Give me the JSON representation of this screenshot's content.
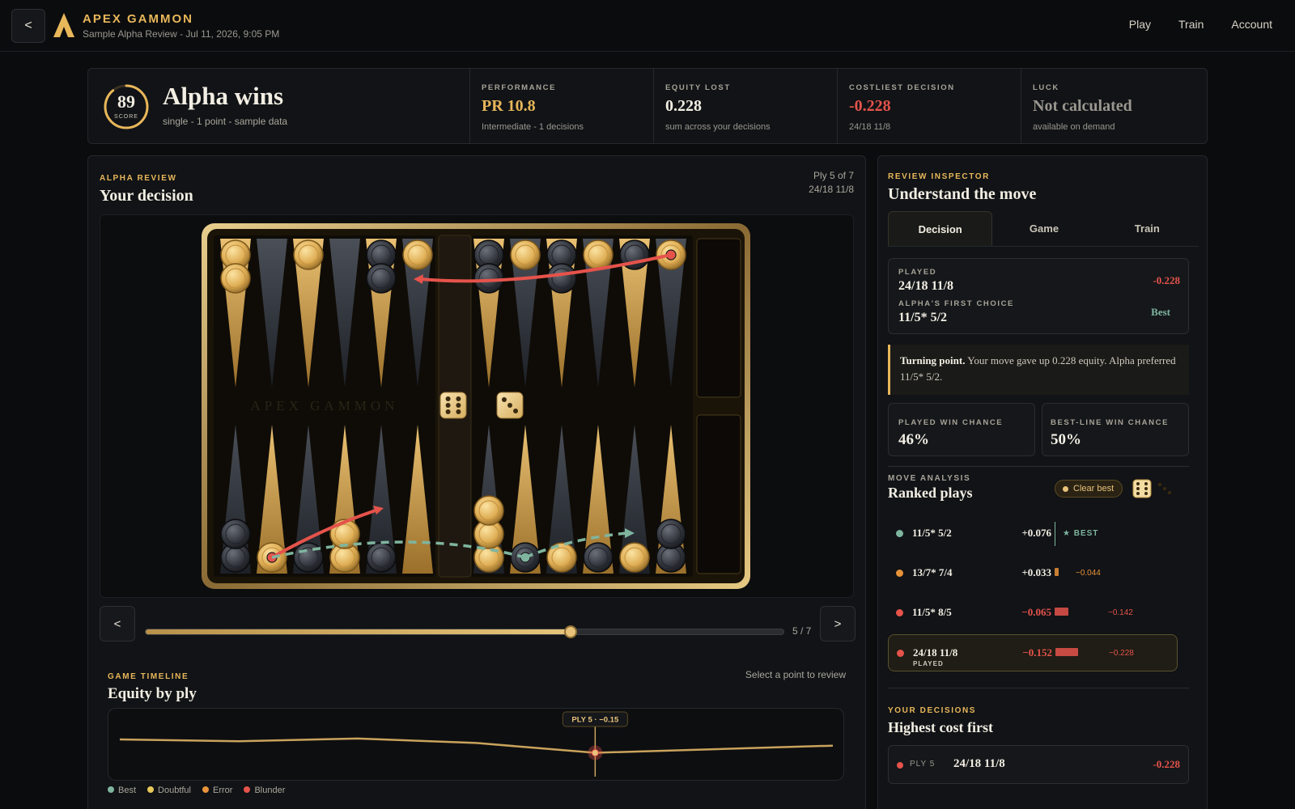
{
  "header": {
    "back_label": "<",
    "brand": "APEX GAMMON",
    "subtitle": "Sample Alpha Review - Jul 11, 2026, 9:05 PM",
    "nav": [
      "Play",
      "Train",
      "Account"
    ]
  },
  "summary": {
    "score": "89",
    "score_label": "SCORE",
    "score_fraction": 0.89,
    "title": "Alpha wins",
    "subtitle": "single - 1 point - sample data",
    "stats": [
      {
        "label": "PERFORMANCE",
        "value": "PR 10.8",
        "sub": "Intermediate - 1 decisions",
        "color": "#e8b75a"
      },
      {
        "label": "EQUITY LOST",
        "value": "0.228",
        "sub": "sum across your decisions",
        "color": "#f2eee3"
      },
      {
        "label": "COSTLIEST DECISION",
        "value": "-0.228",
        "sub": "24/18 11/8",
        "color": "#e5534b"
      },
      {
        "label": "LUCK",
        "value": "Not calculated",
        "sub": "available on demand",
        "color": "#9a978f"
      }
    ]
  },
  "review": {
    "label": "ALPHA REVIEW",
    "title": "Your decision",
    "ply": "Ply 5 of 7",
    "move": "24/18 11/8",
    "board_watermark": "APEX GAMMON",
    "dice": [
      6,
      3
    ],
    "board": {
      "top": [
        {
          "color": "gold",
          "count": 2
        },
        {
          "color": "none",
          "count": 0
        },
        {
          "color": "gold",
          "count": 1
        },
        {
          "color": "none",
          "count": 0
        },
        {
          "color": "dark",
          "count": 2
        },
        {
          "color": "gold",
          "count": 1
        },
        {
          "color": "dark",
          "count": 2
        },
        {
          "color": "gold",
          "count": 1
        },
        {
          "color": "dark",
          "count": 2
        },
        {
          "color": "gold",
          "count": 1
        },
        {
          "color": "dark",
          "count": 1
        },
        {
          "color": "gold",
          "count": 1,
          "marker": "red"
        }
      ],
      "bottom": [
        {
          "color": "dark",
          "count": 2
        },
        {
          "color": "gold",
          "count": 1,
          "marker": "red"
        },
        {
          "color": "dark",
          "count": 1
        },
        {
          "color": "gold",
          "count": 2
        },
        {
          "color": "dark",
          "count": 1
        },
        {
          "color": "none",
          "count": 0
        },
        {
          "color": "gold",
          "count": 3
        },
        {
          "color": "dark",
          "count": 1,
          "marker": "green"
        },
        {
          "color": "gold",
          "count": 1
        },
        {
          "color": "dark",
          "count": 1
        },
        {
          "color": "gold",
          "count": 1
        },
        {
          "color": "dark",
          "count": 2
        }
      ]
    }
  },
  "controls": {
    "prev": "<",
    "next": ">",
    "position": 5,
    "total": 7,
    "count_label": "5 / 7"
  },
  "timeline": {
    "label": "GAME TIMELINE",
    "title": "Equity by ply",
    "hint": "Select a point to review",
    "marker_label": "PLY 5 · −0.15",
    "equity": [
      0.0,
      -0.02,
      0.01,
      -0.04,
      -0.15,
      -0.11,
      -0.07
    ],
    "selected_index": 4,
    "legend": [
      {
        "name": "Best",
        "color": "#7fb59f"
      },
      {
        "name": "Doubtful",
        "color": "#e8c85a"
      },
      {
        "name": "Error",
        "color": "#e8923a"
      },
      {
        "name": "Blunder",
        "color": "#e5534b"
      }
    ]
  },
  "inspector": {
    "label": "REVIEW INSPECTOR",
    "title": "Understand the move",
    "tabs": [
      "Decision",
      "Game",
      "Train"
    ],
    "played_label": "PLAYED",
    "played_move": "24/18 11/8",
    "played_delta": "-0.228",
    "alpha_label": "ALPHA'S FIRST CHOICE",
    "alpha_move": "11/5* 5/2",
    "alpha_tag": "Best",
    "turning_bold": "Turning point.",
    "turning_text": "Your move gave up 0.228 equity. Alpha preferred 11/5* 5/2.",
    "win_played_label": "PLAYED WIN CHANCE",
    "win_played": "46%",
    "win_best_label": "BEST-LINE WIN CHANCE",
    "win_best": "50%",
    "analysis_label": "MOVE ANALYSIS",
    "analysis_title": "Ranked plays",
    "clear_best": "Clear best",
    "plays": [
      {
        "move": "11/5* 5/2",
        "equity": "+0.076",
        "delta": "★ BEST",
        "color": "#7fb59f",
        "loss": 0
      },
      {
        "move": "13/7* 7/4",
        "equity": "+0.033",
        "delta": "−0.044",
        "color": "#e8923a",
        "loss": 0.044
      },
      {
        "move": "11/5* 8/5",
        "equity": "−0.065",
        "delta": "−0.142",
        "color": "#e5534b",
        "loss": 0.142
      },
      {
        "move": "24/18 11/8",
        "equity": "−0.152",
        "delta": "−0.228",
        "color": "#e5534b",
        "loss": 0.228,
        "tag": "PLAYED"
      }
    ],
    "decisions_label": "YOUR DECISIONS",
    "decisions_title": "Highest cost first",
    "decision_row": {
      "ply": "PLY 5",
      "move": "24/18 11/8",
      "delta": "-0.228"
    }
  }
}
